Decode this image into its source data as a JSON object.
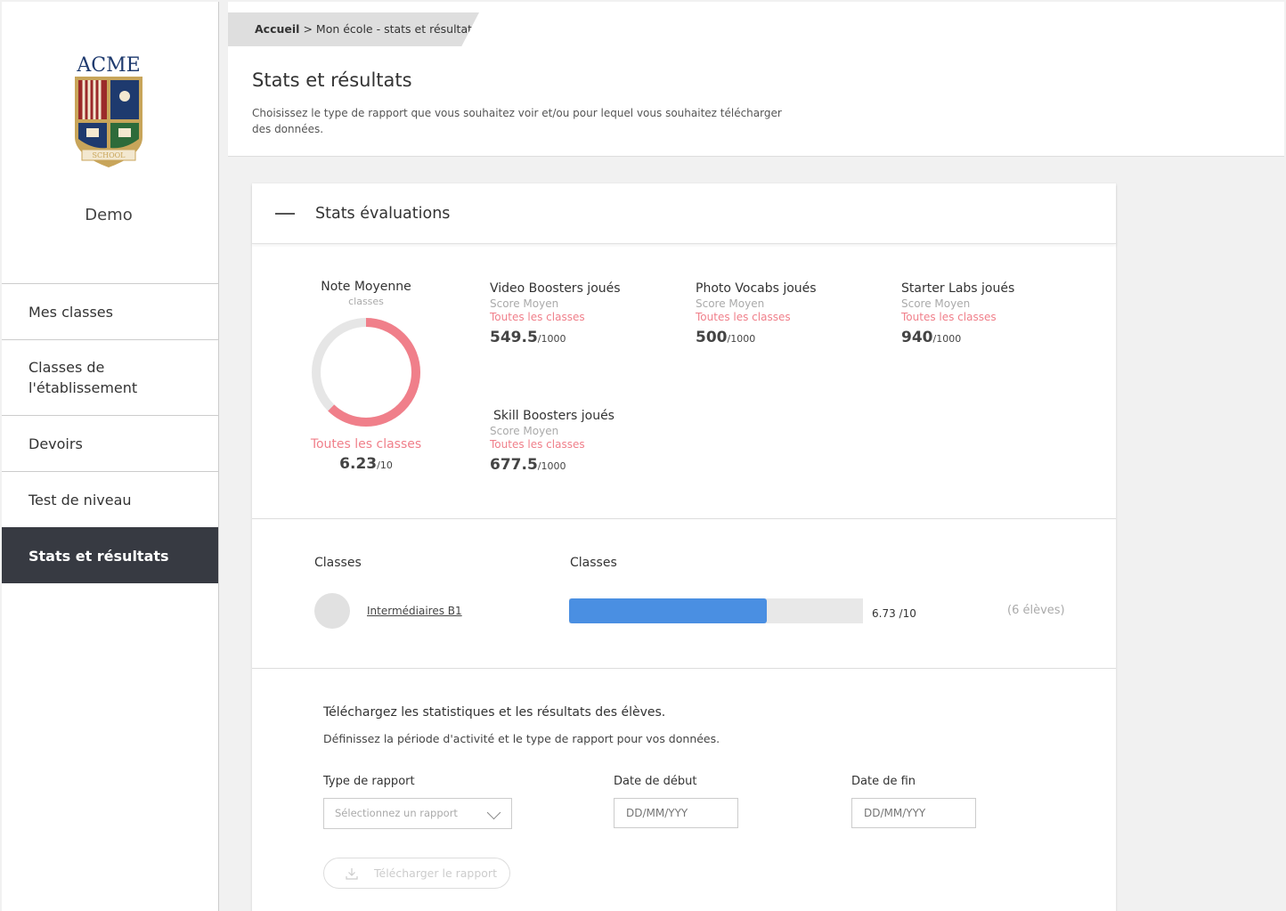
{
  "sidebar": {
    "logo_text": "ACME",
    "logo_banner": "SCHOOL",
    "school_name": "Demo",
    "items": [
      {
        "label": "Mes classes"
      },
      {
        "label": "Classes de l'établissement"
      },
      {
        "label": "Devoirs"
      },
      {
        "label": "Test de niveau"
      },
      {
        "label": "Stats et résultats",
        "active": true
      }
    ]
  },
  "breadcrumb": {
    "home": "Accueil",
    "separator": ">",
    "current": "Mon école - stats et résultats"
  },
  "page": {
    "title": "Stats et résultats",
    "description": "Choisissez le type de rapport que vous souhaitez voir et/ou pour lequel vous souhaitez télécharger des données."
  },
  "eval_card": {
    "title": "Stats évaluations",
    "average": {
      "title": "Note Moyenne",
      "subtitle": "classes",
      "link": "Toutes les classes",
      "value": "6.23",
      "max": "/10",
      "ratio": 0.623
    },
    "stats": [
      {
        "title": "Video Boosters joués",
        "subtitle": "Score Moyen",
        "link": "Toutes les classes",
        "value": "549.5",
        "max": "/1000"
      },
      {
        "title": "Photo Vocabs joués",
        "subtitle": "Score Moyen",
        "link": "Toutes les classes",
        "value": "500",
        "max": "/1000"
      },
      {
        "title": "Starter Labs joués",
        "subtitle": "Score Moyen",
        "link": "Toutes les classes",
        "value": "940",
        "max": "/1000"
      },
      {
        "title": "Skill Boosters joués",
        "subtitle": "Score Moyen",
        "link": "Toutes les classes",
        "value": "677.5",
        "max": "/1000"
      }
    ],
    "classes_table": {
      "col1": "Classes",
      "col2": "Classes",
      "rows": [
        {
          "name": "Intermédiaires B1",
          "score": "6.73 /10",
          "ratio": 0.673,
          "students": "(6 élèves)"
        }
      ]
    }
  },
  "download": {
    "title": "Téléchargez les statistiques et les résultats des élèves.",
    "description": "Définissez la période d'activité et le type de rapport pour vos données.",
    "report_type_label": "Type de rapport",
    "report_type_placeholder": "Sélectionnez un rapport",
    "start_label": "Date de début",
    "start_placeholder": "DD/MM/YYY",
    "end_label": "Date de fin",
    "end_placeholder": "DD/MM/YYY",
    "button_label": "Télécharger le rapport"
  },
  "colors": {
    "accent_pink": "#f07f8a",
    "bar_blue": "#4a8fe2",
    "sidebar_active": "#373a42",
    "logo_gold": "#c8a55a",
    "logo_navy": "#1e3a6e",
    "logo_red": "#9b2a2a",
    "logo_green": "#2d6b3a"
  }
}
